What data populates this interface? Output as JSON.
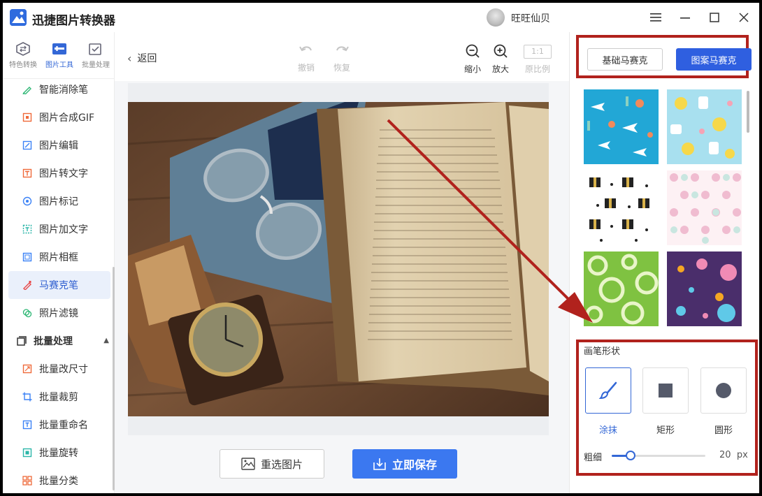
{
  "app": {
    "title": "迅捷图片转换器",
    "user_name": "旺旺仙贝"
  },
  "nav": {
    "tabs": [
      {
        "label": "特色转换",
        "icon": "convert-icon"
      },
      {
        "label": "图片工具",
        "icon": "image-tools-icon",
        "active": true
      },
      {
        "label": "批量处理",
        "icon": "batch-icon"
      }
    ],
    "items": [
      {
        "label": "智能消除笔",
        "icon": "eraser-pen-icon",
        "color": "#2bb673"
      },
      {
        "label": "图片合成GIF",
        "icon": "gif-icon",
        "color": "#ef6a3a"
      },
      {
        "label": "图片编辑",
        "icon": "image-edit-icon",
        "color": "#3b82f6"
      },
      {
        "label": "图片转文字",
        "icon": "ocr-icon",
        "color": "#ef6a3a"
      },
      {
        "label": "图片标记",
        "icon": "marker-icon",
        "color": "#3b82f6"
      },
      {
        "label": "图片加文字",
        "icon": "add-text-icon",
        "color": "#2bb6a8"
      },
      {
        "label": "照片相框",
        "icon": "frame-icon",
        "color": "#3b82f6"
      },
      {
        "label": "马赛克笔",
        "icon": "mosaic-pen-icon",
        "color": "#e84a4a",
        "active": true
      },
      {
        "label": "照片滤镜",
        "icon": "filter-icon",
        "color": "#2bb673"
      }
    ],
    "batch_group": "批量处理",
    "batch_items": [
      {
        "label": "批量改尺寸",
        "icon": "resize-icon",
        "color": "#ef6a3a"
      },
      {
        "label": "批量裁剪",
        "icon": "crop-icon",
        "color": "#3b82f6"
      },
      {
        "label": "批量重命名",
        "icon": "rename-icon",
        "color": "#3b82f6"
      },
      {
        "label": "批量旋转",
        "icon": "rotate-icon",
        "color": "#2bb6a8"
      },
      {
        "label": "批量分类",
        "icon": "classify-icon",
        "color": "#ef6a3a"
      }
    ]
  },
  "toolbar": {
    "back": "返回",
    "undo": "撤销",
    "redo": "恢复",
    "zoom_out": "缩小",
    "zoom_in": "放大",
    "ratio_box": "1:1",
    "ratio": "原比例"
  },
  "actions": {
    "reselect": "重选图片",
    "save": "立即保存"
  },
  "right": {
    "mode_basic": "基础马赛克",
    "mode_pattern": "图案马赛克",
    "brush_title": "画笔形状",
    "shapes": [
      {
        "label": "涂抹",
        "icon": "brush-icon",
        "active": true
      },
      {
        "label": "矩形",
        "icon": "square-icon"
      },
      {
        "label": "圆形",
        "icon": "circle-icon"
      }
    ],
    "size_label": "粗细",
    "size_value": "20",
    "size_unit": "px",
    "size_fraction": 0.2
  },
  "colors": {
    "accent": "#3367d6",
    "primary_button": "#3b78f0",
    "annotation_red": "#b1221d"
  }
}
